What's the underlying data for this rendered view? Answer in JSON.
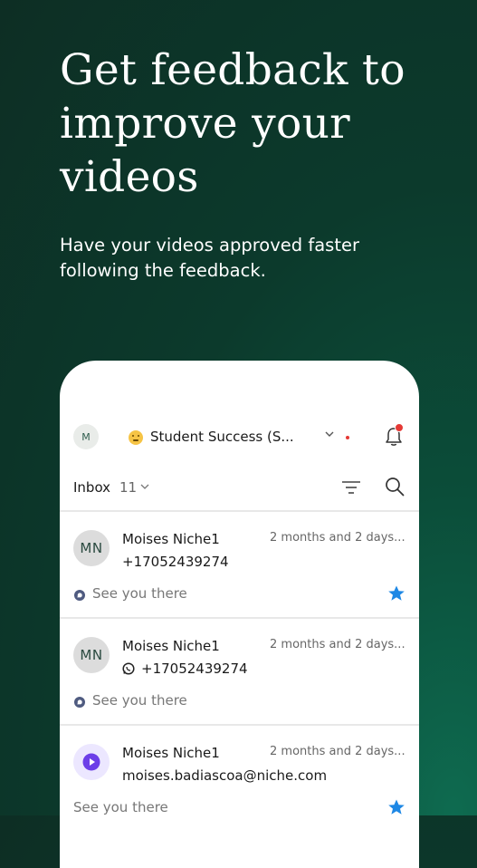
{
  "promo": {
    "headline_line1": "Get feedback to",
    "headline_line2": "improve your",
    "headline_line3": "videos",
    "subtitle_line1": "Have your videos approved faster",
    "subtitle_line2": "following the feedback."
  },
  "topbar": {
    "user_initials": "M",
    "workspace_name": "Student Success (S...",
    "notification_icon": "bell-icon"
  },
  "inbox": {
    "label": "Inbox",
    "count": "11"
  },
  "conversations": [
    {
      "initials": "MN",
      "name": "Moises Niche1",
      "time": "2 months and 2 days...",
      "contact": "+17052439274",
      "preview": "See you there",
      "starred": true
    },
    {
      "initials": "MN",
      "name": "Moises Niche1",
      "time": "2 months and 2 days...",
      "contact": "+17052439274",
      "preview": "See you there",
      "starred": false
    },
    {
      "initials": "",
      "name": "Moises Niche1",
      "time": "2 months and 2 days...",
      "contact": "moises.badiascoa@niche.com",
      "preview": "See you there",
      "starred": true
    }
  ],
  "colors": {
    "background": "#0c3a2c",
    "accent_star": "#1e88e5",
    "notification_dot": "#e53935",
    "avatar_purple": "#6c3ee8"
  }
}
